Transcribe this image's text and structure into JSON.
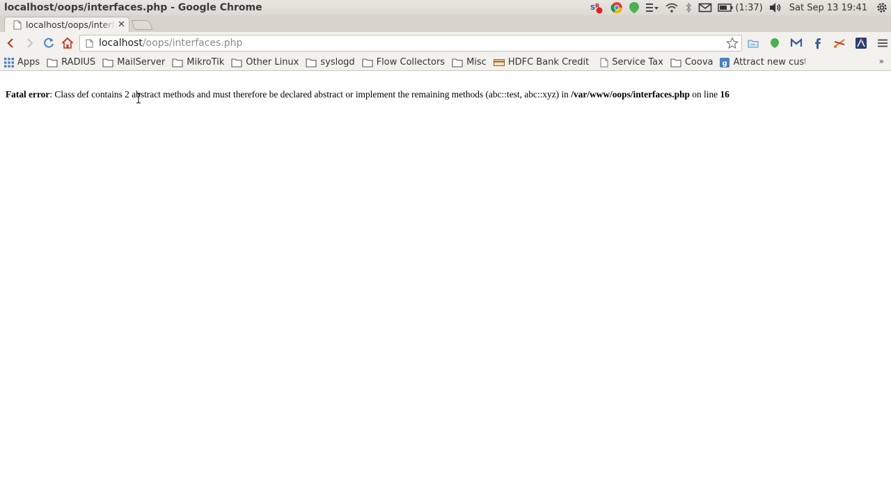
{
  "window": {
    "title": "localhost/oops/interfaces.php - Google Chrome"
  },
  "panel": {
    "battery": "(1:37)",
    "clock": "Sat Sep 13 19:41"
  },
  "tab": {
    "title": "localhost/oops/interfaces.php"
  },
  "omnibox": {
    "host": "localhost",
    "path": "/oops/interfaces.php"
  },
  "bookmarks": [
    {
      "label": "Apps",
      "icon": "apps-grid-icon"
    },
    {
      "label": "RADIUS",
      "icon": "folder-icon"
    },
    {
      "label": "MailServer",
      "icon": "folder-icon"
    },
    {
      "label": "MikroTik",
      "icon": "folder-icon"
    },
    {
      "label": "Other Linux",
      "icon": "folder-icon"
    },
    {
      "label": "syslogd",
      "icon": "folder-icon"
    },
    {
      "label": "Flow Collectors",
      "icon": "folder-icon"
    },
    {
      "label": "Misc",
      "icon": "folder-icon"
    },
    {
      "label": "HDFC Bank Credit",
      "icon": "credit-card-icon"
    },
    {
      "label": "Service Tax",
      "icon": "page-icon"
    },
    {
      "label": "Coova",
      "icon": "folder-icon"
    },
    {
      "label": "Attract new custo",
      "icon": "google-icon"
    }
  ],
  "error": {
    "label": "Fatal error",
    "message": ": Class def contains 2 abstract methods and must therefore be declared abstract or implement the remaining methods (abc::test, abc::xyz) in ",
    "file": "/var/www/oops/interfaces.php",
    "on_line": " on line ",
    "line": "16"
  }
}
